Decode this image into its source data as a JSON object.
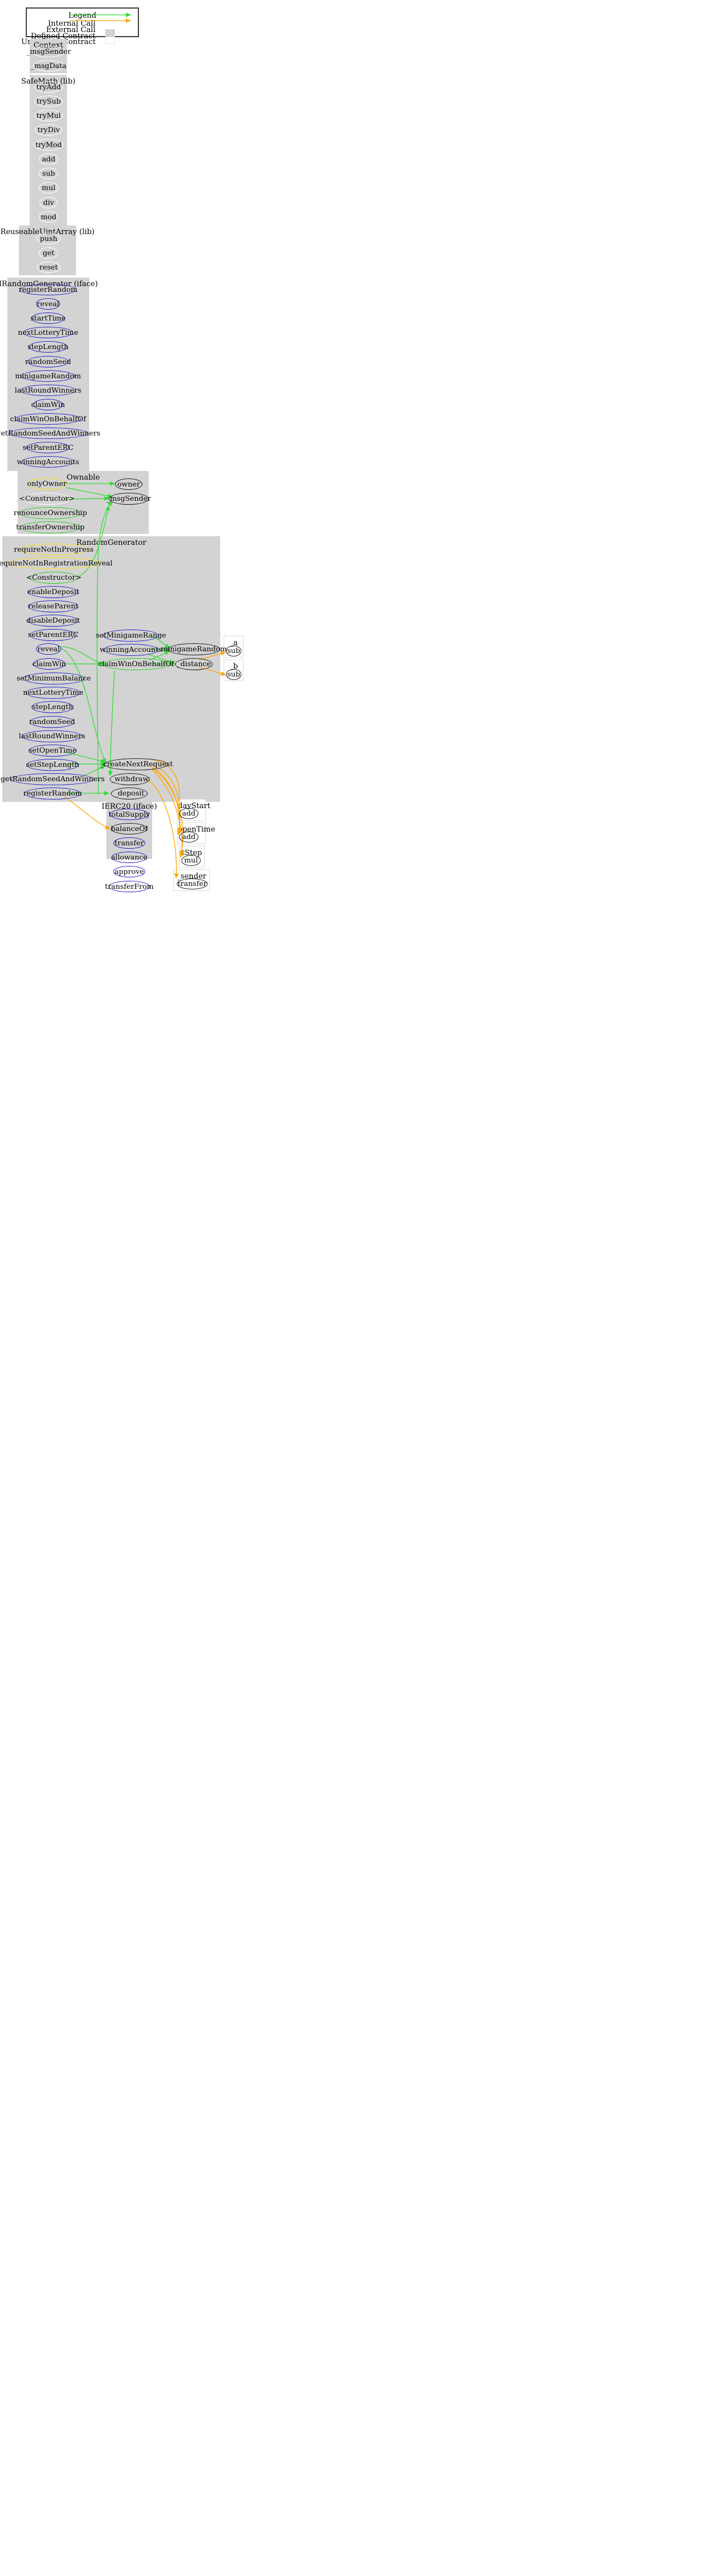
{
  "legend": {
    "title": "Legend",
    "rows": [
      {
        "label": "Internal Call",
        "kind": "arrow",
        "color": "#33dd33"
      },
      {
        "label": "External Call",
        "kind": "arrow",
        "color": "#ffa500"
      },
      {
        "label": "Defined Contract",
        "kind": "swatch",
        "color": "#d3d3d3"
      },
      {
        "label": "Undefined Contract",
        "kind": "swatch",
        "color": "#ffffff"
      }
    ]
  },
  "colors": {
    "internal_call": "#33dd33",
    "external_call": "#ffa500",
    "cluster_fill": "#d3d3d3",
    "node_public": "#22cc22",
    "node_external": "#2222cc",
    "node_internal": "#1a1a1a",
    "node_modifier": "#ffe000",
    "node_private": "#ffffff"
  },
  "clusters": [
    {
      "id": "context",
      "title": "Context",
      "style": "filled",
      "nodes": [
        {
          "id": "ctx_msgSender",
          "label": "_msgSender",
          "color": "white"
        },
        {
          "id": "ctx_msgData",
          "label": "_msgData",
          "color": "white"
        }
      ]
    },
    {
      "id": "safemath",
      "title": "SafeMath  (lib)",
      "style": "filled",
      "nodes": [
        {
          "id": "sm_tryAdd",
          "label": "tryAdd",
          "color": "white"
        },
        {
          "id": "sm_trySub",
          "label": "trySub",
          "color": "white"
        },
        {
          "id": "sm_tryMul",
          "label": "tryMul",
          "color": "white"
        },
        {
          "id": "sm_tryDiv",
          "label": "tryDiv",
          "color": "white"
        },
        {
          "id": "sm_tryMod",
          "label": "tryMod",
          "color": "white"
        },
        {
          "id": "sm_add",
          "label": "add",
          "color": "white"
        },
        {
          "id": "sm_sub",
          "label": "sub",
          "color": "white"
        },
        {
          "id": "sm_mul",
          "label": "mul",
          "color": "white"
        },
        {
          "id": "sm_div",
          "label": "div",
          "color": "white"
        },
        {
          "id": "sm_mod",
          "label": "mod",
          "color": "white"
        }
      ]
    },
    {
      "id": "reuseable",
      "title": "ReuseableUintArray  (lib)",
      "style": "filled",
      "nodes": [
        {
          "id": "ru_push",
          "label": "push",
          "color": "white"
        },
        {
          "id": "ru_get",
          "label": "get",
          "color": "white"
        },
        {
          "id": "ru_reset",
          "label": "reset",
          "color": "white"
        }
      ]
    },
    {
      "id": "irandomgenerator",
      "title": "IRandomGenerator  (iface)",
      "style": "filled",
      "nodes": [
        {
          "id": "irg_registerRandom",
          "label": "registerRandom",
          "color": "blue"
        },
        {
          "id": "irg_reveal",
          "label": "reveal",
          "color": "blue"
        },
        {
          "id": "irg_startTime",
          "label": "startTime",
          "color": "blue"
        },
        {
          "id": "irg_nextLotteryTime",
          "label": "nextLotteryTime",
          "color": "blue"
        },
        {
          "id": "irg_stepLength",
          "label": "stepLength",
          "color": "blue"
        },
        {
          "id": "irg_randomSeed",
          "label": "randomSeed",
          "color": "blue"
        },
        {
          "id": "irg_minigameRandom",
          "label": "minigameRandom",
          "color": "blue"
        },
        {
          "id": "irg_lastRoundWinners",
          "label": "lastRoundWinners",
          "color": "blue"
        },
        {
          "id": "irg_claimWin",
          "label": "claimWin",
          "color": "blue"
        },
        {
          "id": "irg_claimWinOnBehalfOf",
          "label": "claimWinOnBehalfOf",
          "color": "blue"
        },
        {
          "id": "irg_getRandomSeedAndWinners",
          "label": "getRandomSeedAndWinners",
          "color": "blue"
        },
        {
          "id": "irg_setParentERC",
          "label": "setParentERC",
          "color": "blue"
        },
        {
          "id": "irg_winningAccounts",
          "label": "winningAccounts",
          "color": "blue"
        }
      ]
    },
    {
      "id": "ownable",
      "title": "Ownable",
      "style": "filled",
      "nodes": [
        {
          "id": "ow_onlyOwner",
          "label": "onlyOwner",
          "color": "yellow"
        },
        {
          "id": "ow_constructor",
          "label": "<Constructor>",
          "color": "white"
        },
        {
          "id": "ow_renounceOwnership",
          "label": "renounceOwnership",
          "color": "green"
        },
        {
          "id": "ow_transferOwnership",
          "label": "transferOwnership",
          "color": "green"
        },
        {
          "id": "ow_owner",
          "label": "owner",
          "color": "black"
        },
        {
          "id": "ow_msgSender",
          "label": "_msgSender",
          "color": "black"
        }
      ]
    },
    {
      "id": "randomgenerator",
      "title": "RandomGenerator",
      "style": "filled",
      "nodes": [
        {
          "id": "rg_requireNotInProgress",
          "label": "requireNotInProgress",
          "color": "yellow"
        },
        {
          "id": "rg_requireNotInRegistrationReveal",
          "label": "requireNotInRegistrationReveal",
          "color": "yellow"
        },
        {
          "id": "rg_constructor",
          "label": "<Constructor>",
          "color": "green"
        },
        {
          "id": "rg_enableDeposit",
          "label": "enableDeposit",
          "color": "blue"
        },
        {
          "id": "rg_releaseParent",
          "label": "releaseParent",
          "color": "blue"
        },
        {
          "id": "rg_disableDeposit",
          "label": "disableDeposit",
          "color": "blue"
        },
        {
          "id": "rg_setParentERC",
          "label": "setParentERC",
          "color": "blue"
        },
        {
          "id": "rg_reveal",
          "label": "reveal",
          "color": "blue"
        },
        {
          "id": "rg_claimWin",
          "label": "claimWin",
          "color": "blue"
        },
        {
          "id": "rg_setMinimumBalance",
          "label": "setMinimumBalance",
          "color": "blue"
        },
        {
          "id": "rg_nextLotteryTime",
          "label": "nextLotteryTime",
          "color": "blue"
        },
        {
          "id": "rg_stepLength",
          "label": "stepLength",
          "color": "blue"
        },
        {
          "id": "rg_randomSeed",
          "label": "randomSeed",
          "color": "blue"
        },
        {
          "id": "rg_lastRoundWinners",
          "label": "lastRoundWinners",
          "color": "blue"
        },
        {
          "id": "rg_setOpenTime",
          "label": "setOpenTime",
          "color": "blue"
        },
        {
          "id": "rg_setStepLength",
          "label": "setStepLength",
          "color": "blue"
        },
        {
          "id": "rg_getRandomSeedAndWinners",
          "label": "getRandomSeedAndWinners",
          "color": "blue"
        },
        {
          "id": "rg_registerRandom",
          "label": "registerRandom",
          "color": "blue"
        },
        {
          "id": "rg_setMinigameRange",
          "label": "setMinigameRange",
          "color": "blue"
        },
        {
          "id": "rg_winningAccounts",
          "label": "winningAccounts",
          "color": "blue"
        },
        {
          "id": "rg_claimWinOnBehalfOf",
          "label": "claimWinOnBehalfOf",
          "color": "green"
        },
        {
          "id": "rg_minigameRandom",
          "label": "minigameRandom",
          "color": "black"
        },
        {
          "id": "rg_distance",
          "label": "_distance",
          "color": "black"
        },
        {
          "id": "rg_createNextRequest",
          "label": "_createNextRequest",
          "color": "black"
        },
        {
          "id": "rg_withdraw",
          "label": "_withdraw",
          "color": "black"
        },
        {
          "id": "rg_deposit",
          "label": "_deposit",
          "color": "black"
        }
      ]
    },
    {
      "id": "ierc20",
      "title": "IERC20  (iface)",
      "style": "filled",
      "nodes": [
        {
          "id": "erc_totalSupply",
          "label": "totalSupply",
          "color": "blue"
        },
        {
          "id": "erc_balanceOf",
          "label": "balanceOf",
          "color": "black"
        },
        {
          "id": "erc_transfer",
          "label": "transfer",
          "color": "blue"
        },
        {
          "id": "erc_allowance",
          "label": "allowance",
          "color": "blue"
        },
        {
          "id": "erc_approve",
          "label": "approve",
          "color": "blue"
        },
        {
          "id": "erc_transferFrom",
          "label": "transferFrom",
          "color": "blue"
        }
      ]
    },
    {
      "id": "a_cluster",
      "title": "_a",
      "style": "outline",
      "nodes": [
        {
          "id": "a_sub",
          "label": "sub",
          "color": "black"
        }
      ]
    },
    {
      "id": "b_cluster",
      "title": "_b",
      "style": "outline",
      "nodes": [
        {
          "id": "b_sub",
          "label": "sub",
          "color": "black"
        }
      ]
    },
    {
      "id": "daystart_cluster",
      "title": "dayStart",
      "style": "outline",
      "nodes": [
        {
          "id": "ds_add",
          "label": "add",
          "color": "black"
        }
      ]
    },
    {
      "id": "opentime_cluster",
      "title": "openTime",
      "style": "outline",
      "nodes": [
        {
          "id": "ot_add",
          "label": "add",
          "color": "black"
        }
      ]
    },
    {
      "id": "tstep_cluster",
      "title": "tStep",
      "style": "outline",
      "nodes": [
        {
          "id": "ts_mul",
          "label": "mul",
          "color": "black"
        }
      ]
    },
    {
      "id": "sender_cluster",
      "title": "_sender",
      "style": "outline",
      "nodes": [
        {
          "id": "sd_transfer",
          "label": "transfer",
          "color": "black"
        }
      ]
    }
  ],
  "edges": [
    {
      "from": "ow_onlyOwner",
      "to": "ow_owner",
      "type": "internal"
    },
    {
      "from": "ow_onlyOwner",
      "to": "ow_msgSender",
      "type": "internal"
    },
    {
      "from": "ow_constructor",
      "to": "ow_msgSender",
      "type": "internal"
    },
    {
      "from": "rg_constructor",
      "to": "ow_msgSender",
      "type": "internal"
    },
    {
      "from": "rg_reveal",
      "to": "rg_claimWinOnBehalfOf",
      "type": "internal"
    },
    {
      "from": "rg_claimWin",
      "to": "rg_claimWinOnBehalfOf",
      "type": "internal"
    },
    {
      "from": "rg_setMinigameRange",
      "to": "rg_minigameRandom",
      "type": "internal"
    },
    {
      "from": "rg_winningAccounts",
      "to": "rg_minigameRandom",
      "type": "internal"
    },
    {
      "from": "rg_winningAccounts",
      "to": "rg_distance",
      "type": "internal"
    },
    {
      "from": "rg_claimWinOnBehalfOf",
      "to": "rg_minigameRandom",
      "type": "internal"
    },
    {
      "from": "rg_claimWinOnBehalfOf",
      "to": "rg_distance",
      "type": "internal"
    },
    {
      "from": "rg_setOpenTime",
      "to": "rg_createNextRequest",
      "type": "internal"
    },
    {
      "from": "rg_setStepLength",
      "to": "rg_createNextRequest",
      "type": "internal"
    },
    {
      "from": "rg_getRandomSeedAndWinners",
      "to": "rg_createNextRequest",
      "type": "internal"
    },
    {
      "from": "rg_reveal",
      "to": "rg_createNextRequest",
      "type": "internal"
    },
    {
      "from": "rg_claimWinOnBehalfOf",
      "to": "rg_withdraw",
      "type": "internal"
    },
    {
      "from": "rg_registerRandom",
      "to": "rg_deposit",
      "type": "internal"
    },
    {
      "from": "rg_distance",
      "to": "a_sub",
      "type": "external"
    },
    {
      "from": "rg_distance",
      "to": "b_sub",
      "type": "external"
    },
    {
      "from": "rg_createNextRequest",
      "to": "ds_add",
      "type": "external"
    },
    {
      "from": "rg_createNextRequest",
      "to": "ot_add",
      "type": "external"
    },
    {
      "from": "rg_createNextRequest",
      "to": "ts_mul",
      "type": "external"
    },
    {
      "from": "rg_withdraw",
      "to": "sd_transfer",
      "type": "external"
    },
    {
      "from": "rg_registerRandom",
      "to": "erc_balanceOf",
      "type": "external"
    }
  ]
}
